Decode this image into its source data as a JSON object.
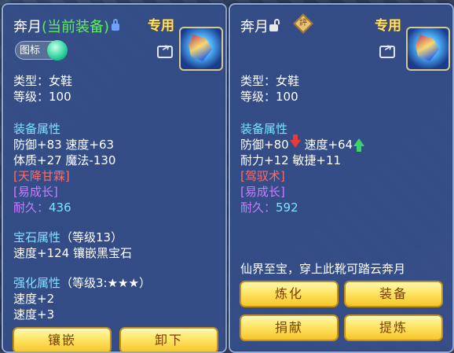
{
  "left": {
    "name_prefix": "奔月",
    "name_status": "(当前装备)",
    "exclusive_label": "专用",
    "icon_toggle_label": "图标",
    "type_line": "类型：女鞋",
    "level_line": "等级：100",
    "equip_attr_title": "装备属性",
    "attr_line_1": "防御+83 速度+63",
    "attr_line_2": "体质+27 魔法-130",
    "special_skill": "[天降甘霖]",
    "special_effect": "[易成长]",
    "durability_label": "耐久：",
    "durability_value": "436",
    "gem_title": "宝石属性",
    "gem_level": "（等级13）",
    "gem_line": "速度+124 镶嵌黑宝石",
    "enhance_title": "强化属性",
    "enhance_level": "（等级3:★★★）",
    "enhance_line_1": "速度+2",
    "enhance_line_2": "速度+3",
    "buttons": {
      "inlay": "镶嵌",
      "unequip": "卸下"
    }
  },
  "right": {
    "name": "奔月",
    "seal_char": "評",
    "exclusive_label": "专用",
    "type_line": "类型：女鞋",
    "level_line": "等级：100",
    "equip_attr_title": "装备属性",
    "attr_def": "防御+80",
    "attr_speed": "速度+64",
    "attr_line_2": "耐力+12 敏捷+11",
    "special_skill": "[驾驭术]",
    "special_effect": "[易成长]",
    "durability_label": "耐久：",
    "durability_value": "592",
    "description": "仙界至宝，穿上此靴可踏云奔月",
    "buttons": {
      "refine": "炼化",
      "equip": "装备",
      "donate": "捐献",
      "extract": "提炼"
    }
  },
  "icons": [
    "lock-icon",
    "unlock-icon",
    "share-icon",
    "toggle-icon",
    "boots-item-icon",
    "down-arrow-icon",
    "up-arrow-icon"
  ],
  "colors": {
    "panel": "#344e8a",
    "section_title": "#7fe2ff",
    "status_green": "#5cf05c",
    "skill_red": "#ff6a6a",
    "effect_purple": "#c77dff",
    "button_gold": "#ffe566"
  }
}
